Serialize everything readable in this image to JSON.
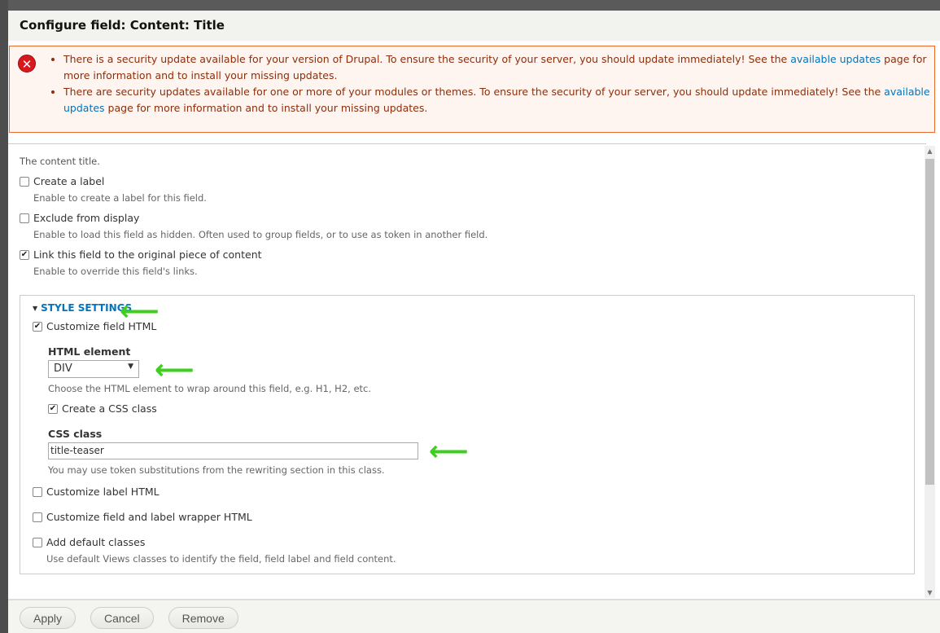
{
  "dialog": {
    "title": "Configure field: Content: Title"
  },
  "messages": [
    {
      "pre": "There is a security update available for your version of Drupal. To ensure the security of your server, you should update immediately! See the ",
      "link": "available updates",
      "post": " page for more information and to install your missing updates."
    },
    {
      "pre": "There are security updates available for one or more of your modules or themes. To ensure the security of your server, you should update immediately! See the ",
      "link": "available updates",
      "post": " page for more information and to install your missing updates."
    }
  ],
  "form": {
    "description": "The content title.",
    "create_label": {
      "label": "Create a label",
      "checked": false,
      "help": "Enable to create a label for this field."
    },
    "exclude": {
      "label": "Exclude from display",
      "checked": false,
      "help": "Enable to load this field as hidden. Often used to group fields, or to use as token in another field."
    },
    "link": {
      "label": "Link this field to the original piece of content",
      "checked": true,
      "help": "Enable to override this field's links."
    },
    "style": {
      "legend": "STYLE SETTINGS",
      "customize_field": {
        "label": "Customize field HTML",
        "checked": true
      },
      "html_element": {
        "label": "HTML element",
        "value": "DIV",
        "help": "Choose the HTML element to wrap around this field, e.g. H1, H2, etc."
      },
      "create_css": {
        "label": "Create a CSS class",
        "checked": true
      },
      "css_class": {
        "label": "CSS class",
        "value": "title-teaser",
        "help": "You may use token substitutions from the rewriting section in this class."
      },
      "customize_label": {
        "label": "Customize label HTML",
        "checked": false
      },
      "customize_wrapper": {
        "label": "Customize field and label wrapper HTML",
        "checked": false
      },
      "default_classes": {
        "label": "Add default classes",
        "checked": false,
        "help": "Use default Views classes to identify the field, field label and field content."
      }
    }
  },
  "buttons": {
    "apply": "Apply",
    "cancel": "Cancel",
    "remove": "Remove"
  },
  "colors": {
    "accent": "#0074bd",
    "error": "#d8171e",
    "annotation": "#3ecf1c"
  }
}
